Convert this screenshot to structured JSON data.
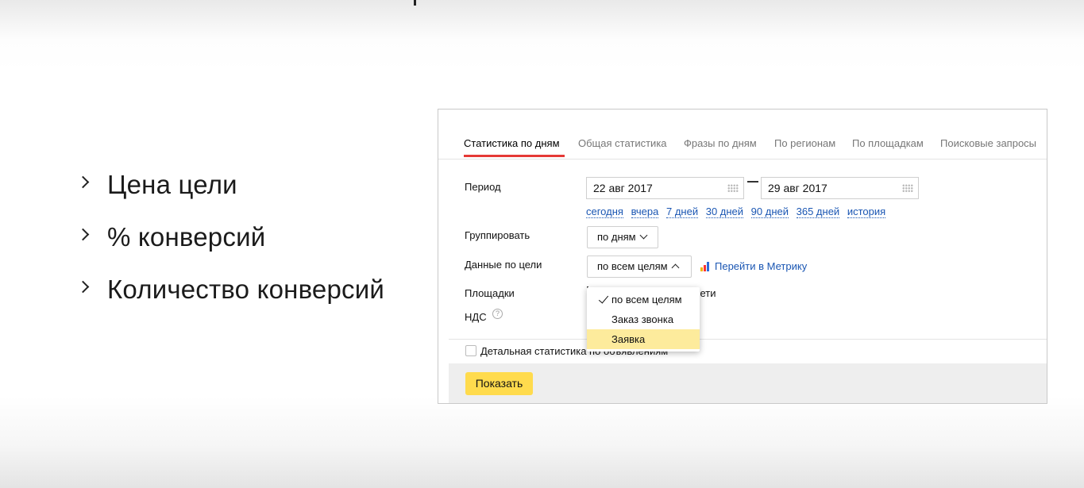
{
  "slide": {
    "bullets": [
      "Цена цели",
      "% конверсий",
      "Количество конверсий"
    ]
  },
  "panel": {
    "tabs": [
      {
        "label": "Статистика по дням",
        "active": true
      },
      {
        "label": "Общая статистика",
        "active": false
      },
      {
        "label": "Фразы по дням",
        "active": false
      },
      {
        "label": "По регионам",
        "active": false
      },
      {
        "label": "По площадкам",
        "active": false
      },
      {
        "label": "Поисковые запросы",
        "active": false
      }
    ],
    "period": {
      "label": "Период",
      "from": "22 авг 2017",
      "to": "29 авг 2017",
      "quick_links": [
        "сегодня",
        "вчера",
        "7 дней",
        "30 дней",
        "90 дней",
        "365 дней",
        "история"
      ]
    },
    "group": {
      "label": "Группировать",
      "value": "по дням"
    },
    "goal": {
      "label": "Данные по цели",
      "value": "по всем целям",
      "metrika_link": "Перейти в Метрику",
      "dropdown": [
        {
          "label": "по всем целям",
          "selected": true,
          "highlighted": false
        },
        {
          "label": "Заказ звонка",
          "selected": false,
          "highlighted": false
        },
        {
          "label": "Заявка",
          "selected": false,
          "highlighted": true
        }
      ]
    },
    "placements": {
      "label": "Площадки",
      "partial_text": "сети"
    },
    "vat": {
      "label": "НДС",
      "help": "?"
    },
    "detail": {
      "label": "Детальная статистика по объявлениям"
    },
    "show_button": "Показать"
  },
  "colors": {
    "accent_red": "#e53935",
    "link_blue": "#1a56b3",
    "button_yellow": "#ffdb4d",
    "highlight_yellow": "#fdeb9c"
  }
}
